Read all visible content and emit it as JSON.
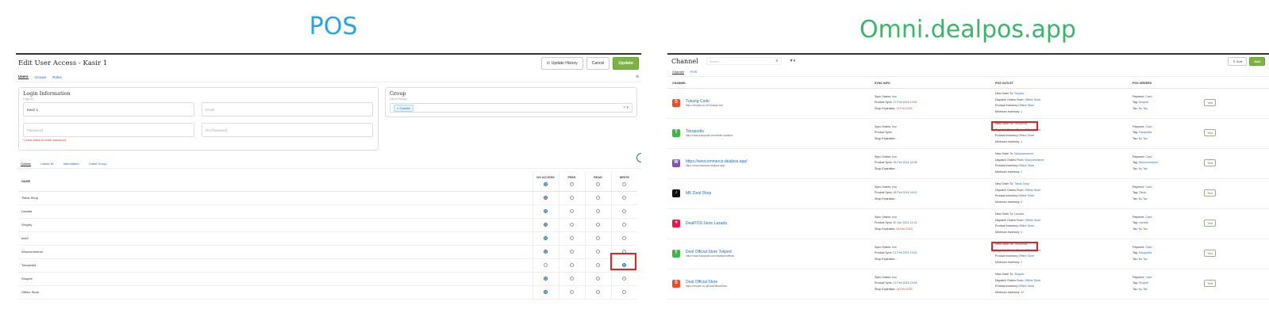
{
  "pos_title": "POS",
  "omni_title": "Omni.dealpos.app",
  "pos": {
    "title": "Edit User Access - Kasir 1",
    "buttons": {
      "update_history": "Update History",
      "cancel": "Cancel",
      "update": "Update"
    },
    "tabs": [
      "Users",
      "Groups",
      "Roles"
    ],
    "login": {
      "title": "Login Information",
      "sub": "Login ID",
      "login_id_value": "Kasir 1",
      "email_placeholder": "Email",
      "password_placeholder": "Password",
      "repassword_placeholder": "Re-Password",
      "hint": "*Leave blank to retain password"
    },
    "group": {
      "title": "Group",
      "sub": "List of Groups",
      "chip": "Cashier",
      "clear": "×",
      "caret": "▾"
    },
    "sub_tabs": [
      "Outlets",
      "Linked ID",
      "Information",
      "Outlet Group"
    ],
    "columns": [
      "NAME",
      "NO ACCESS",
      "PEEK",
      "READ",
      "WRITE"
    ],
    "rows": [
      {
        "name": "Tiktok Shop",
        "sel": 0
      },
      {
        "name": "Lazada",
        "sel": 0
      },
      {
        "name": "Shopify",
        "sel": 0
      },
      {
        "name": "test2",
        "sel": 0
      },
      {
        "name": "Woocommerce",
        "sel": 0
      },
      {
        "name": "Tokopedia",
        "sel": 3
      },
      {
        "name": "Shopee",
        "sel": 0
      },
      {
        "name": "Offline Store",
        "sel": 0
      }
    ]
  },
  "omni": {
    "title": "Channel",
    "search_placeholder": "Search...",
    "filter_glyph": "▼▾",
    "buttons": {
      "sort": "Sort",
      "add": "Add"
    },
    "tabs": [
      "Channel",
      "POS"
    ],
    "columns": [
      "CHANNEL",
      "SYNC INFO",
      "POS OUTLET",
      "POS ORDERS"
    ],
    "labels": {
      "sync_orders": "Sync Orders:",
      "product_sync": "Product Sync:",
      "shop_expiration": "Shop Expiration:",
      "new_order_to": "New Order To:",
      "dispatch_from": "Dispatch Orders From:",
      "product_inventory": "Product Inventory:",
      "min_inventory": "Minimum Inventory:",
      "payment": "Payment:",
      "tag": "Tag:",
      "tax": "Tax:",
      "test": "Test"
    },
    "rows": [
      {
        "icon": "shopee",
        "icon_char": "S",
        "color": "#ee4d2d",
        "name": "Tukang Code",
        "url": "https://shopee.co.id/TukangCode",
        "sync_orders": "true",
        "product_sync": "21 Feb 2024 13:52",
        "expiration": "20 Feb 2025",
        "exp_red": true,
        "new_order_to": "Shopee",
        "dispatch": "Offline Store",
        "inventory": "Offline Store",
        "min_inv": "1",
        "payment": "Cash",
        "tag": "Shopee",
        "tax": "No Tax"
      },
      {
        "icon": "tokopedia",
        "icon_char": "T",
        "color": "#42b549",
        "name": "Tokopedia",
        "url": "https://www.tokopedia.com/seller-sandbox",
        "sync_orders": "true",
        "product_sync": "",
        "expiration": "-",
        "exp_red": false,
        "new_order_to": "Tokopedia",
        "dispatch": "Offline Store",
        "inventory": "Offline Store",
        "min_inv": "1",
        "payment": "Cash",
        "tag": "Tokopedia",
        "tax": "No Tax"
      },
      {
        "icon": "woocommerce",
        "icon_char": "W",
        "color": "#7f54b3",
        "name": "https://woocommerce.dealpos.app/",
        "url": "https://woocommerce.dealpos.app/",
        "sync_orders": "true",
        "product_sync": "05 Feb 2024 10:06",
        "expiration": "-",
        "exp_red": false,
        "new_order_to": "Woocommerce",
        "dispatch": "Woocommerce",
        "inventory": "Offline Store",
        "min_inv": "1",
        "payment": "Cash",
        "tag": "Woocommerce",
        "tax": "No Tax"
      },
      {
        "icon": "tiktok",
        "icon_char": "♪",
        "color": "#111111",
        "name": "MK Deal Shop",
        "url": "",
        "sync_orders": "true",
        "product_sync": "06 Feb 2024 16:51",
        "expiration": "-",
        "exp_red": false,
        "new_order_to": "Tiktok Shop",
        "dispatch": "Offline Store",
        "inventory": "Offline Store",
        "min_inv": "0",
        "payment": "Cash",
        "tag": "Tiktok",
        "tax": "No Tax"
      },
      {
        "icon": "lazada",
        "icon_char": "♥",
        "color": "#f5114c",
        "name": "DealPOS Store Lazada",
        "url": "",
        "sync_orders": "true",
        "product_sync": "30 Jan 2024 13:14",
        "expiration": "08 Dec 2023",
        "exp_red": true,
        "new_order_to": "Lazada",
        "dispatch": "Offline Store",
        "inventory": "Offline Store",
        "min_inv": "0",
        "payment": "Cash",
        "tag": "Lazada",
        "tax": "No Tax"
      },
      {
        "icon": "tokopedia",
        "icon_char": "T",
        "color": "#42b549",
        "name": "Deal Official Store Tokped",
        "url": "https://www.tokopedia.com/dealstoreofficial",
        "sync_orders": "true",
        "product_sync": "21 Feb 2024 13:52",
        "expiration": "-",
        "exp_red": false,
        "new_order_to": "Tokopedia",
        "dispatch": "Offline Store",
        "inventory": "Offline Store",
        "min_inv": "2",
        "payment": "Cash",
        "tag": "Tokopedia",
        "tax": "No Tax"
      },
      {
        "icon": "shopee",
        "icon_char": "S",
        "color": "#ee4d2d",
        "name": "Deal Official Store",
        "url": "https://shopee.co.id/DealOfficialStore",
        "sync_orders": "true",
        "product_sync": "21 Feb 2024 13:46",
        "expiration": "14 Feb 2025",
        "exp_red": true,
        "new_order_to": "Shopee",
        "dispatch": "Offline Store",
        "inventory": "Offline Store",
        "min_inv": "10",
        "payment": "Cash",
        "tag": "Shopee",
        "tax": "No Tax"
      }
    ]
  }
}
